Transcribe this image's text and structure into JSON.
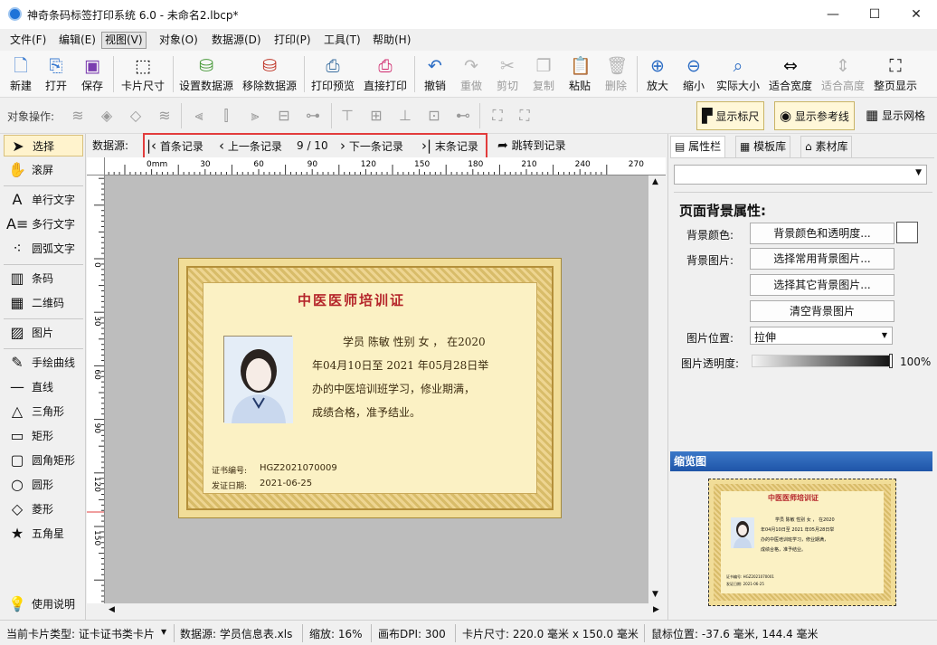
{
  "window": {
    "title": "神奇条码标签打印系统 6.0 - 未命名2.lbcp*",
    "minimize": "—",
    "maximize": "☐",
    "close": "✕"
  },
  "menu": [
    "文件(F)",
    "编辑(E)",
    "视图(V)",
    "对象(O)",
    "数据源(D)",
    "打印(P)",
    "工具(T)",
    "帮助(H)"
  ],
  "toolbar": {
    "new": "新建",
    "open": "打开",
    "save": "保存",
    "card_size": "卡片尺寸",
    "set_datasource": "设置数据源",
    "remove_datasource": "移除数据源",
    "print_preview": "打印预览",
    "direct_print": "直接打印",
    "undo": "撤销",
    "redo": "重做",
    "cut": "剪切",
    "copy": "复制",
    "paste": "粘贴",
    "delete": "删除",
    "zoom_in": "放大",
    "zoom_out": "缩小",
    "actual_size": "实际大小",
    "fit_width": "适合宽度",
    "fit_height": "适合高度",
    "fit_page": "整页显示"
  },
  "objbar": {
    "label": "对象操作:",
    "show_ruler": "显示标尺",
    "show_guides": "显示参考线",
    "show_grid": "显示网格"
  },
  "tools": {
    "select": "选择",
    "scroll": "滚屏",
    "single_text": "单行文字",
    "multi_text": "多行文字",
    "arc_text": "圆弧文字",
    "barcode": "条码",
    "qrcode": "二维码",
    "image": "图片",
    "freehand": "手绘曲线",
    "line": "直线",
    "triangle": "三角形",
    "rect": "矩形",
    "round_rect": "圆角矩形",
    "circle": "圆形",
    "diamond": "菱形",
    "star": "五角星",
    "help": "使用说明"
  },
  "nav": {
    "label": "数据源:",
    "first": "首条记录",
    "prev": "上一条记录",
    "position": "9 / 10",
    "next": "下一条记录",
    "last": "末条记录",
    "goto": "跳转到记录"
  },
  "ruler": {
    "h_labels": [
      "30",
      "0mm",
      "30",
      "60",
      "90",
      "120",
      "150",
      "180",
      "210",
      "240",
      "270"
    ],
    "v_labels": [
      "0",
      "30",
      "60",
      "90",
      "120",
      "150"
    ]
  },
  "card": {
    "title": "中医医师培训证",
    "line1": "学员 陈敏   性别 女 ， 在2020",
    "line2": "年04月10日至  2021  年05月28日举",
    "line3": "办的中医培训班学习，修业期满，",
    "line4": "成绩合格，准予结业。",
    "cert_no_label": "证书编号:",
    "cert_no": "HGZ2021070009",
    "issue_date_label": "发证日期:",
    "issue_date": "2021-06-25"
  },
  "preview_card": {
    "title": "中医医师培训证",
    "line1": "学员 陈敏   性别 女 ， 在2020",
    "line2": "年04月10日至 2021 年05月28日举",
    "line3": "办的中医培训班学习，修业期满，",
    "line4": "成绩合格，准予结业。",
    "cert_no": "证书编号: HGZ2021070001",
    "issue_date": "发证日期: 2021-06-25"
  },
  "right": {
    "tabs": [
      "属性栏",
      "模板库",
      "素材库"
    ],
    "section_title": "页面背景属性:",
    "bg_color_label": "背景颜色:",
    "bg_color_btn": "背景颜色和透明度...",
    "bg_image_label": "背景图片:",
    "bg_common_btn": "选择常用背景图片...",
    "bg_other_btn": "选择其它背景图片...",
    "bg_clear_btn": "清空背景图片",
    "img_pos_label": "图片位置:",
    "img_pos_value": "拉伸",
    "img_opacity_label": "图片透明度:",
    "img_opacity_value": "100%",
    "preview_title": "缩览图"
  },
  "status": {
    "card_type": "当前卡片类型: 证卡证书类卡片",
    "datasource": "数据源: 学员信息表.xls",
    "zoom": "缩放: 16%",
    "dpi": "画布DPI:  300",
    "card_size": "卡片尺寸: 220.0 毫米 x 150.0 毫米",
    "mouse_pos": "鼠标位置: -37.6 毫米, 144.4 毫米"
  },
  "colors": {
    "accent": "#1e73d8",
    "highlight": "#e23c3c",
    "card_bg": "#fbf1c4",
    "title_red": "#b5262b"
  }
}
